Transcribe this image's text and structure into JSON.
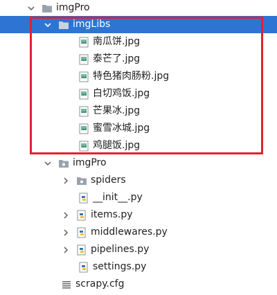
{
  "tree": {
    "root": {
      "label": "imgPro"
    },
    "imglibs": {
      "label": "imgLibs",
      "files": [
        {
          "label": "南瓜饼.jpg"
        },
        {
          "label": "泰芒了.jpg"
        },
        {
          "label": "特色猪肉肠粉.jpg"
        },
        {
          "label": "白切鸡饭.jpg"
        },
        {
          "label": "芒果冰.jpg"
        },
        {
          "label": "蜜雪冰城.jpg"
        },
        {
          "label": "鸡腿饭.jpg"
        }
      ]
    },
    "package": {
      "label": "imgPro",
      "spiders": {
        "label": "spiders"
      },
      "init": {
        "label": "__init__.py"
      },
      "items": {
        "label": "items.py"
      },
      "middlewares": {
        "label": "middlewares.py"
      },
      "pipelines": {
        "label": "pipelines.py"
      },
      "settings": {
        "label": "settings.py"
      }
    },
    "scrapy_cfg": {
      "label": "scrapy.cfg"
    }
  },
  "colors": {
    "selection": "#2e74d3",
    "highlight_border": "#e3202f",
    "folder": "#9aa3ad",
    "python_blue": "#3a75b0",
    "python_yellow": "#f2c230"
  }
}
